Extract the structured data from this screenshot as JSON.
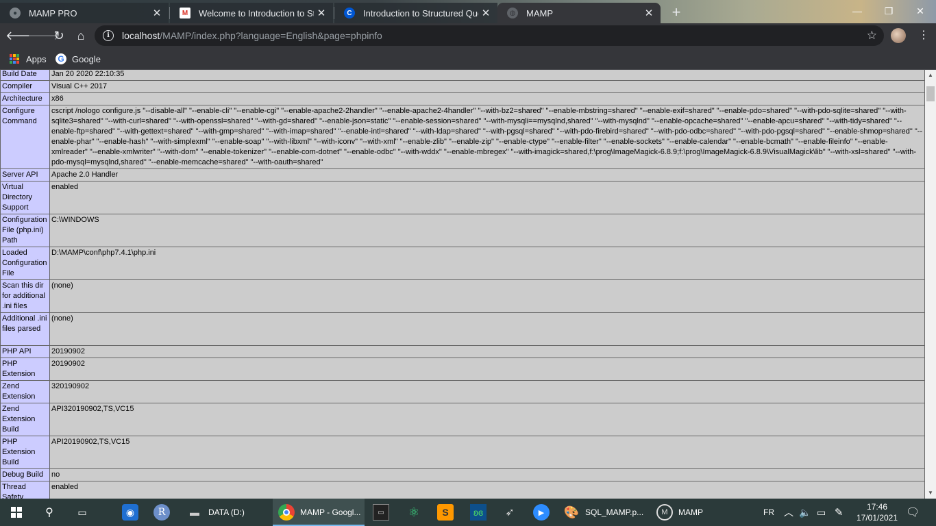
{
  "browser": {
    "tabs": [
      {
        "title": "MAMP PRO"
      },
      {
        "title": "Welcome to Introduction to Structured Query Language (SQL)"
      },
      {
        "title": "Introduction to Structured Query Language (SQL)"
      },
      {
        "title": "MAMP"
      }
    ],
    "url_host": "localhost",
    "url_path": "/MAMP/index.php?language=English&page=phpinfo",
    "bookmarks": [
      {
        "label": "Apps"
      },
      {
        "label": "Google"
      }
    ]
  },
  "phpinfo": {
    "rows": [
      {
        "key": "Build Date",
        "value": "Jan 20 2020 22:10:35"
      },
      {
        "key": "Compiler",
        "value": "Visual C++ 2017"
      },
      {
        "key": "Architecture",
        "value": "x86"
      },
      {
        "key": "Configure Command",
        "value": "cscript /nologo configure.js \"--disable-all\" \"--enable-cli\" \"--enable-cgi\" \"--enable-apache2-2handler\" \"--enable-apache2-4handler\" \"--with-bz2=shared\" \"--enable-mbstring=shared\" \"--enable-exif=shared\" \"--enable-pdo=shared\" \"--with-pdo-sqlite=shared\" \"--with-sqlite3=shared\" \"--with-curl=shared\" \"--with-openssl=shared\" \"--with-gd=shared\" \"--enable-json=static\" \"--enable-session=shared\" \"--with-mysqli==mysqlnd,shared\" \"--with-mysqlnd\" \"--enable-opcache=shared\" \"--enable-apcu=shared\" \"--with-tidy=shared\" \"--enable-ftp=shared\" \"--with-gettext=shared\" \"--with-gmp=shared\" \"--with-imap=shared\" \"--enable-intl=shared\" \"--with-ldap=shared\" \"--with-pgsql=shared\" \"--with-pdo-firebird=shared\" \"--with-pdo-odbc=shared\" \"--with-pdo-pgsql=shared\" \"--enable-shmop=shared\" \"--enable-phar\" \"--enable-hash\" \"--with-simplexml\" \"--enable-soap\" \"--with-libxml\" \"--with-iconv\" \"--with-xml\" \"--enable-zlib\" \"--enable-zip\" \"--enable-ctype\" \"--enable-filter\" \"--enable-sockets\" \"--enable-calendar\" \"--enable-bcmath\" \"--enable-fileinfo\" \"--enable-xmlreader\" \"--enable-xmlwriter\" \"--with-dom\" \"--enable-tokenizer\" \"--enable-com-dotnet\" \"--enable-odbc\" \"--with-wddx\" \"--enable-mbregex\" \"--with-imagick=shared,f:\\prog\\ImageMagick-6.8.9;f:\\prog\\ImageMagick-6.8.9\\VisualMagick\\lib\" \"--with-xsl=shared\" \"--with-pdo-mysql=mysqlnd,shared\" \"--enable-memcache=shared\" \"--with-oauth=shared\""
      },
      {
        "key": "Server API",
        "value": "Apache 2.0 Handler"
      },
      {
        "key": "Virtual Directory Support",
        "value": "enabled"
      },
      {
        "key": "Configuration File (php.ini) Path",
        "value": "C:\\WINDOWS"
      },
      {
        "key": "Loaded Configuration File",
        "value": "D:\\MAMP\\conf\\php7.4.1\\php.ini"
      },
      {
        "key": "Scan this dir for additional .ini files",
        "value": "(none)"
      },
      {
        "key": "Additional .ini files parsed",
        "value": "(none)"
      },
      {
        "key": "PHP API",
        "value": "20190902"
      },
      {
        "key": "PHP Extension",
        "value": "20190902"
      },
      {
        "key": "Zend Extension",
        "value": "320190902"
      },
      {
        "key": "Zend Extension Build",
        "value": "API320190902,TS,VC15"
      },
      {
        "key": "PHP Extension Build",
        "value": "API20190902,TS,VC15"
      },
      {
        "key": "Debug Build",
        "value": "no"
      },
      {
        "key": "Thread Safety",
        "value": "enabled"
      }
    ]
  },
  "taskbar": {
    "items": [
      {
        "label": "DATA (D:)"
      },
      {
        "label": "MAMP - Googl..."
      },
      {
        "label": "SQL_MAMP.p..."
      },
      {
        "label": "MAMP"
      }
    ],
    "language": "FR",
    "time": "17:46",
    "date": "17/01/2021"
  },
  "colors": {
    "key_cell": "#ccccff",
    "value_cell": "#cccccc",
    "chrome_toolbar": "#35363a",
    "taskbar": "#2b3a3a"
  },
  "icons": [
    "mamp-icon",
    "gmail-icon",
    "coursera-icon",
    "globe-icon",
    "back-icon",
    "forward-icon",
    "reload-icon",
    "home-icon",
    "info-icon",
    "star-icon",
    "apps-icon",
    "google-icon",
    "windows-start-icon",
    "search-icon",
    "task-view-icon",
    "chrome-icon",
    "terminal-icon",
    "sublime-icon",
    "zoom-icon"
  ]
}
